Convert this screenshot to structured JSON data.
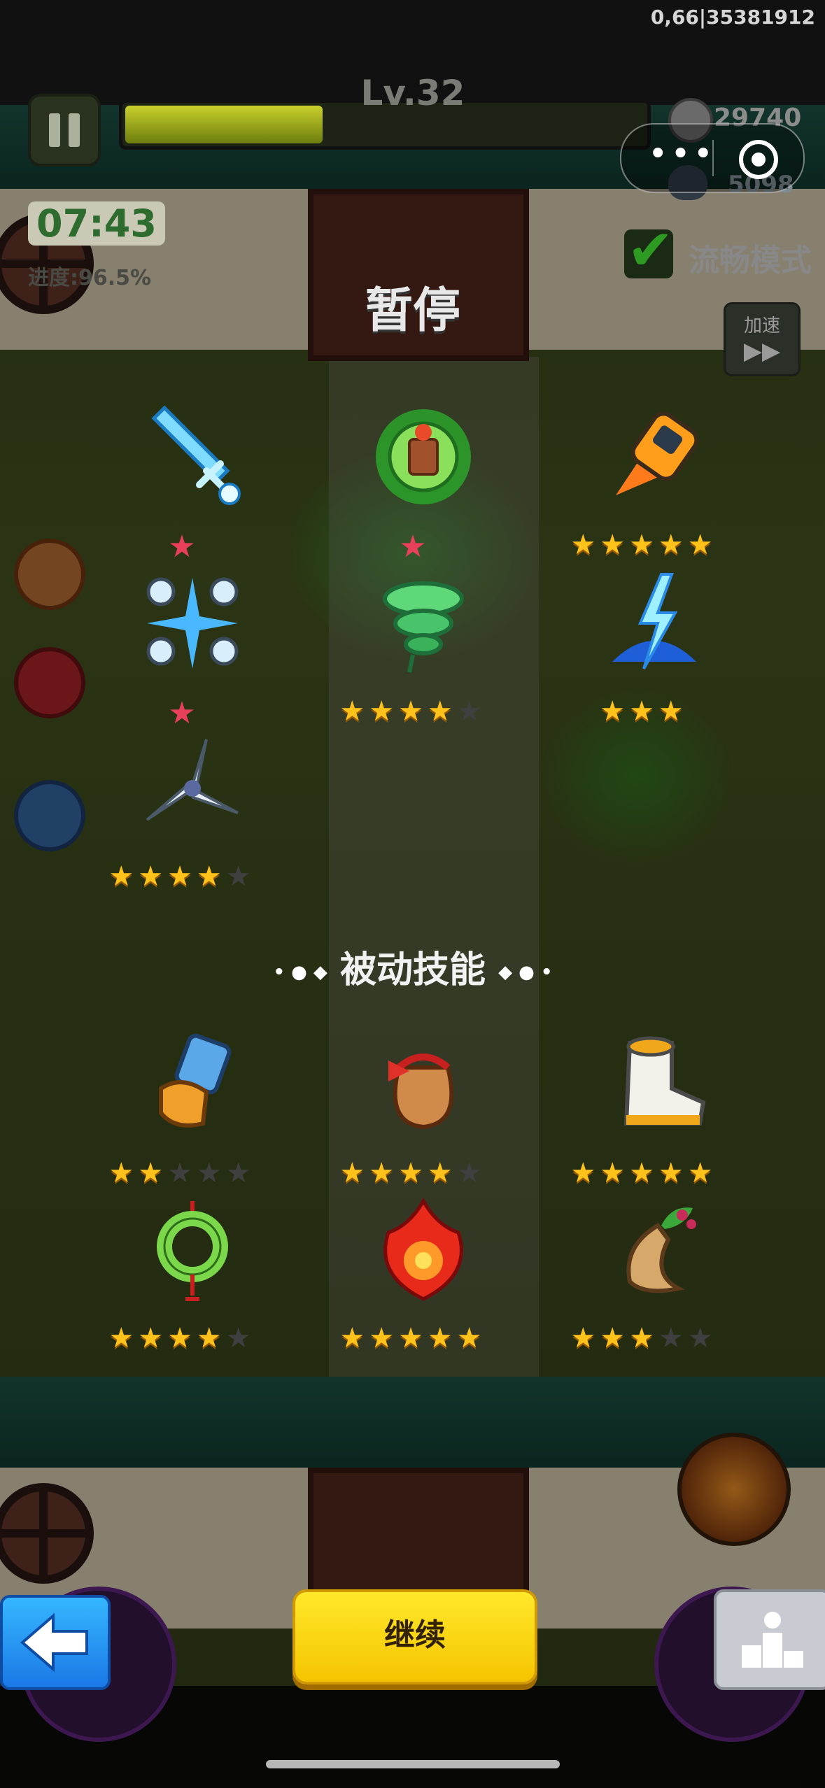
{
  "status_bar": {
    "text": "0,66|35381912"
  },
  "hud": {
    "level": "Lv.32",
    "level_progress": 0.38,
    "coins": "29740",
    "kills": "5098",
    "timer": "07:43",
    "progress": "进度:96.5%",
    "smooth_mode_label": "流畅模式",
    "smooth_mode_checked": true,
    "speed_label": "加速",
    "speed_icon": "fast-forward-icon"
  },
  "mini_program": {
    "menu_icon": "more-dots-icon",
    "close_icon": "target-close-icon"
  },
  "pause_title": "暂停",
  "active_skills": [
    {
      "icon": "ice-sword-icon",
      "stars": 0,
      "max": 5,
      "evolved": true
    },
    {
      "icon": "green-totem-icon",
      "stars": 0,
      "max": 5,
      "evolved": true
    },
    {
      "icon": "rocket-fist-icon",
      "stars": 5,
      "max": 5,
      "evolved": false
    },
    {
      "icon": "ice-orbs-icon",
      "stars": 0,
      "max": 5,
      "evolved": true
    },
    {
      "icon": "whirlwind-icon",
      "stars": 4,
      "max": 5,
      "evolved": false
    },
    {
      "icon": "lightning-icon",
      "stars": 3,
      "max": 3,
      "evolved": false
    },
    {
      "icon": "shuriken-icon",
      "stars": 4,
      "max": 5,
      "evolved": false
    }
  ],
  "passive_header": "被动技能",
  "passive_skills": [
    {
      "icon": "gauntlet-icon",
      "stars": 2,
      "max": 5
    },
    {
      "icon": "lucky-bag-icon",
      "stars": 4,
      "max": 5
    },
    {
      "icon": "boots-icon",
      "stars": 5,
      "max": 5
    },
    {
      "icon": "jade-ring-icon",
      "stars": 4,
      "max": 5
    },
    {
      "icon": "fire-spirit-icon",
      "stars": 5,
      "max": 5
    },
    {
      "icon": "ginseng-icon",
      "stars": 3,
      "max": 5
    }
  ],
  "buttons": {
    "continue": "继续",
    "back_icon": "back-arrow-icon",
    "rank_icon": "podium-icon"
  },
  "colors": {
    "star": "#ffc21a",
    "continue": "#ffe92a",
    "back": "#36b7ff"
  }
}
